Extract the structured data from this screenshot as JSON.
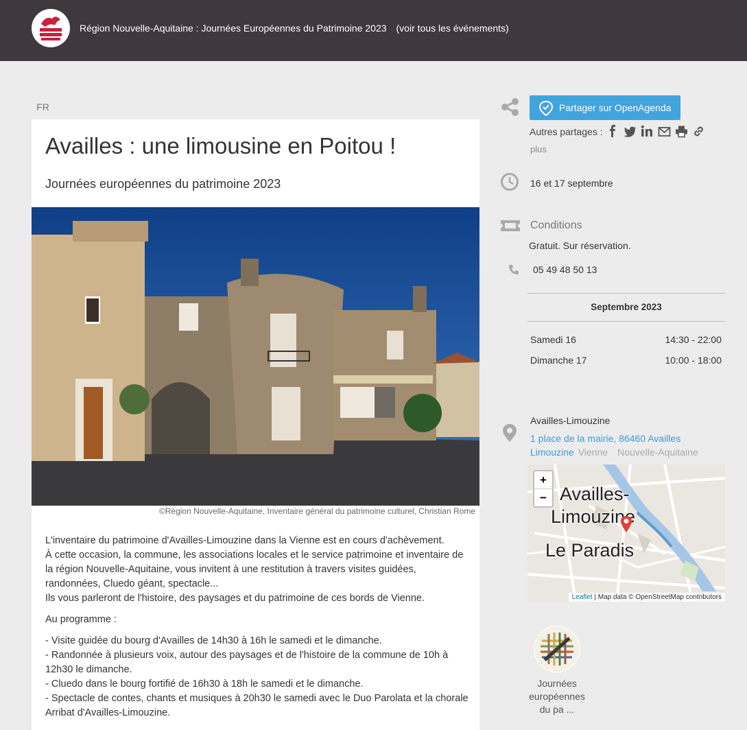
{
  "header": {
    "title": "Région Nouvelle-Aquitaine : Journées Européennes du Patrimoine 2023",
    "see_all": "(voir tous les événements)",
    "logo_text": "Région Nouvelle-Aquitaine"
  },
  "event": {
    "lang_tab": "FR",
    "title": "Availles : une limousine en Poitou !",
    "subtitle": "Journées européennes du patrimoine 2023",
    "image_credit": "©Région Nouvelle-Aquitaine, Inventaire général du patrimoine culturel, Christian Rome",
    "description": {
      "p1_l1": "L'inventaire du patrimoine d'Availles-Limouzine dans la Vienne est en cours d'achèvement.",
      "p1_l2": "À cette occasion, la commune, les associations locales et le service patrimoine et inventaire de la région Nouvelle-Aquitaine, vous invitent à une restitution à travers visites guidées, randonnées, Cluedo géant, spectacle...",
      "p1_l3": "Ils vous parleront de l'histoire, des paysages et du patrimoine de ces bords de Vienne.",
      "p2": "Au programme :",
      "items": [
        "- Visite guidée du bourg d'Availles de 14h30 à 16h le samedi et le dimanche.",
        "- Randonnée à plusieurs voix, autour des paysages et de l'histoire de la commune de 10h à 12h30 le dimanche.",
        "- Cluedo dans le bourg fortifié de 16h30 à 18h le samedi et le dimanche.",
        "- Spectacle de contes, chants et musiques à 20h30 le samedi avec le Duo Parolata et la chorale Arribat d'Availles-Limouzine."
      ]
    }
  },
  "sidebar": {
    "share_button": "Partager sur OpenAgenda",
    "other_shares": "Autres partages :",
    "plus": "plus",
    "dates": "16 et 17 septembre",
    "conditions_title": "Conditions",
    "conditions_text": "Gratuit. Sur réservation.",
    "phone": "05 49 48 50 13",
    "schedule": {
      "month": "Septembre 2023",
      "rows": [
        {
          "day": "Samedi 16",
          "time": "14:30 - 22:00"
        },
        {
          "day": "Dimanche 17",
          "time": "10:00 - 18:00"
        }
      ]
    },
    "location": {
      "name": "Availles-Limouzine",
      "address": "1 place de la mairie, 86460 Availles Limouzine",
      "department": "Vienne",
      "region": "Nouvelle-Aquitaine"
    },
    "map": {
      "zoom_in": "+",
      "zoom_out": "−",
      "label_town_1": "Availles-",
      "label_town_2": "Limouzine",
      "label_place": "Le Paradis",
      "attrib_link": "Leaflet",
      "attrib_text": " | Map data © OpenStreetMap contributors"
    },
    "agenda_name": "Journées européennes du pa ..."
  },
  "colors": {
    "header_bg": "#3f393d",
    "share_button": "#41a4dd",
    "link": "#3d9bd6",
    "map_pin": "#e0403a",
    "river": "#6aa9dc"
  }
}
